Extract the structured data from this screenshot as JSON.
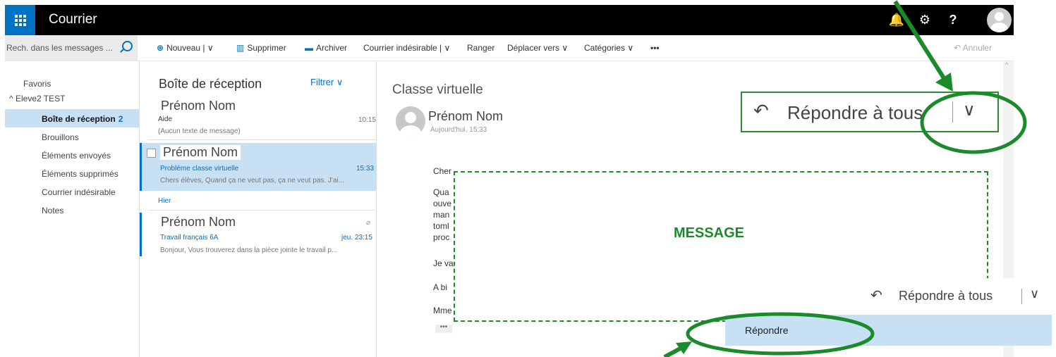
{
  "app": {
    "title": "Courrier"
  },
  "topbar": {
    "bell": "🔔",
    "gear": "⚙",
    "help": "?"
  },
  "search": {
    "placeholder": "Rech. dans les messages ..."
  },
  "toolbar": {
    "new": "Nouveau |",
    "delete": "Supprimer",
    "archive": "Archiver",
    "junk": "Courrier indésirable |",
    "sweep": "Ranger",
    "move": "Déplacer vers",
    "categories": "Catégories",
    "more": "•••",
    "undo": "Annuler"
  },
  "nav": {
    "favorites": "Favoris",
    "account": "Eleve2 TEST",
    "items": [
      {
        "label": "Boîte de réception",
        "count": "2"
      },
      {
        "label": "Brouillons"
      },
      {
        "label": "Éléments envoyés"
      },
      {
        "label": "Éléments supprimés"
      },
      {
        "label": "Courrier indésirable"
      },
      {
        "label": "Notes"
      }
    ]
  },
  "list": {
    "title": "Boîte de réception",
    "filter": "Filtrer",
    "group": "Hier",
    "messages": [
      {
        "from": "Prénom Nom",
        "subject": "Aide",
        "time": "10:15",
        "preview": "(Aucun texte de message)"
      },
      {
        "from": "Prénom Nom",
        "subject": "Problème classe virtuelle",
        "time": "15:33",
        "preview": "Chers élèves, Quand ça ne veut pas, ça ne veut pas. J'ai..."
      },
      {
        "from": "Prénom Nom",
        "subject": "Travail français 6A",
        "time": "jeu. 23:15",
        "preview": "Bonjour, Vous trouverez dans la pièce jointe le travail p..."
      }
    ]
  },
  "reading": {
    "subject": "Classe virtuelle",
    "sender": "Prénom Nom",
    "date": "Aujourd'hui, 15:33",
    "body_lines": [
      "Cher",
      "Qua",
      "ouve",
      "man",
      "toml",
      "proc",
      "Je va",
      "A bi",
      "Mme"
    ],
    "more": "•••"
  },
  "reply": {
    "icon": "↶",
    "label": "Répondre à tous",
    "chevron": "∨"
  },
  "annotation": {
    "message": "MESSAGE"
  },
  "menu": {
    "reply": "Répondre"
  },
  "colors": {
    "brand": "#0072c6",
    "annotation": "#1a8a2a",
    "selected": "#c7e0f4"
  }
}
